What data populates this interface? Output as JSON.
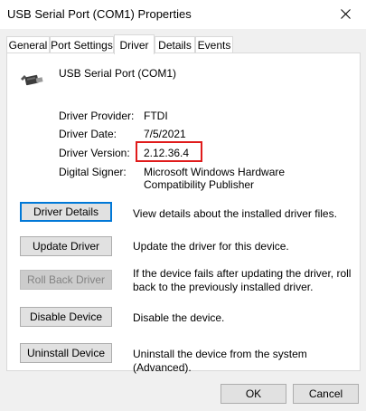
{
  "window": {
    "title": "USB Serial Port (COM1) Properties"
  },
  "tabs": [
    {
      "label": "General"
    },
    {
      "label": "Port Settings"
    },
    {
      "label": "Driver",
      "active": true
    },
    {
      "label": "Details"
    },
    {
      "label": "Events"
    }
  ],
  "device": {
    "name": "USB Serial Port (COM1)",
    "icon": "usb-serial-port-icon"
  },
  "driver_info": {
    "provider_label": "Driver Provider:",
    "provider": "FTDI",
    "date_label": "Driver Date:",
    "date": "7/5/2021",
    "version_label": "Driver Version:",
    "version": "2.12.36.4",
    "signer_label": "Digital Signer:",
    "signer": "Microsoft Windows Hardware Compatibility Publisher"
  },
  "actions": [
    {
      "label": "Driver Details",
      "description": "View details about the installed driver files.",
      "enabled": true,
      "default": true
    },
    {
      "label": "Update Driver",
      "description": "Update the driver for this device.",
      "enabled": true
    },
    {
      "label": "Roll Back Driver",
      "description": "If the device fails after updating the driver, roll back to the previously installed driver.",
      "enabled": false
    },
    {
      "label": "Disable Device",
      "description": "Disable the device.",
      "enabled": true
    },
    {
      "label": "Uninstall Device",
      "description": "Uninstall the device from the system (Advanced).",
      "enabled": true
    }
  ],
  "dialog_buttons": {
    "ok": "OK",
    "cancel": "Cancel"
  },
  "colors": {
    "highlight_box": "#e01b1b",
    "default_button_border": "#0078d7"
  }
}
